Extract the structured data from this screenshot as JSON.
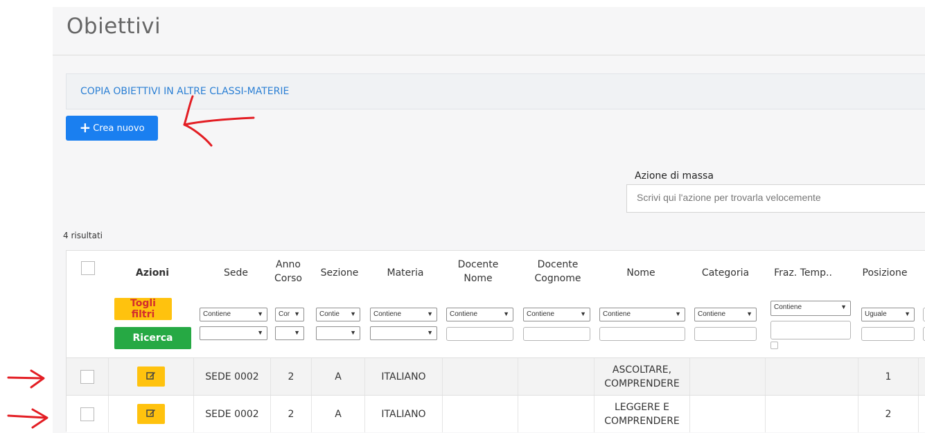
{
  "page": {
    "title": "Obiettivi",
    "copy_link": "COPIA OBIETTIVI IN ALTRE CLASSI-MATERIE",
    "new_button": "Crea nuovo",
    "mass_action": {
      "label": "Azione di massa",
      "placeholder": "Scrivi qui l'azione per trovarla velocemente"
    },
    "result_count": "4 risultati"
  },
  "table": {
    "headers": {
      "actions": "Azioni",
      "sede": "Sede",
      "anno_line1": "Anno",
      "anno_line2": "Corso",
      "sezione": "Sezione",
      "materia": "Materia",
      "docente_nome_line1": "Docente",
      "docente_nome_line2": "Nome",
      "docente_cognome_line1": "Docente",
      "docente_cognome_line2": "Cognome",
      "nome": "Nome",
      "categoria": "Categoria",
      "fraz_temp": "Fraz. Temp..",
      "posizione": "Posizione"
    },
    "filter_buttons": {
      "clear": "Togli filtri",
      "search": "Ricerca"
    },
    "filter_options": {
      "sede": "Contiene",
      "anno": "Cor",
      "sezione": "Contie",
      "materia": "Contiene",
      "docente_nome": "Contiene",
      "docente_cognome": "Contiene",
      "nome": "Contiene",
      "categoria": "Contiene",
      "fraz_temp": "Contiene",
      "posizione": "Uguale"
    },
    "rows": [
      {
        "sede": "SEDE 0002",
        "anno": "2",
        "sezione": "A",
        "materia": "ITALIANO",
        "docente_nome": "",
        "docente_cognome": "",
        "nome_line1": "ASCOLTARE,",
        "nome_line2": "COMPRENDERE",
        "categoria": "",
        "fraz_temp": "",
        "posizione": "1"
      },
      {
        "sede": "SEDE 0002",
        "anno": "2",
        "sezione": "A",
        "materia": "ITALIANO",
        "docente_nome": "",
        "docente_cognome": "",
        "nome_line1": "LEGGERE E",
        "nome_line2": "COMPRENDERE",
        "categoria": "",
        "fraz_temp": "",
        "posizione": "2"
      }
    ]
  },
  "icons": [
    "plus-icon",
    "edit-icon",
    "annotation-arrow-icon"
  ],
  "colors": {
    "primary": "#1a7ff0",
    "link": "#2a7fd4",
    "warning": "#ffc20e",
    "success": "#26a944",
    "danger": "#d32d2d",
    "annotation": "#e31e24"
  }
}
